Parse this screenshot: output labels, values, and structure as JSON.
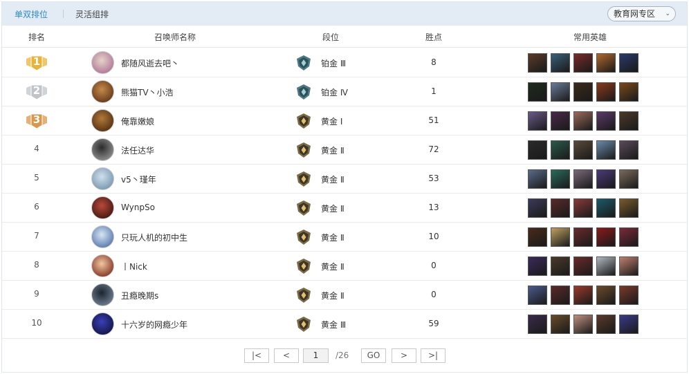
{
  "tabs": {
    "solo": "单双排位",
    "flex": "灵活组排"
  },
  "region": {
    "label": "教育网专区"
  },
  "columns": {
    "rank": "排名",
    "summoner": "召唤师名称",
    "tier": "段位",
    "lp": "胜点",
    "champs": "常用英雄"
  },
  "rows": [
    {
      "rank": "1",
      "name": "都随风逝去吧丶",
      "tier": "铂金 Ⅲ",
      "lp": "8"
    },
    {
      "rank": "2",
      "name": "熊猫TV丶小浩",
      "tier": "铂金 Ⅳ",
      "lp": "1"
    },
    {
      "rank": "3",
      "name": "俺靠嫩娘",
      "tier": "黄金 Ⅰ",
      "lp": "51"
    },
    {
      "rank": "4",
      "name": "法任达华",
      "tier": "黄金 Ⅱ",
      "lp": "72"
    },
    {
      "rank": "5",
      "name": "v5丶瑾年",
      "tier": "黄金 Ⅱ",
      "lp": "53"
    },
    {
      "rank": "6",
      "name": "WynpSo",
      "tier": "黄金 Ⅱ",
      "lp": "13"
    },
    {
      "rank": "7",
      "name": "只玩人机的初中生",
      "tier": "黄金 Ⅱ",
      "lp": "10"
    },
    {
      "rank": "8",
      "name": "丨Nick",
      "tier": "黄金 Ⅱ",
      "lp": "0"
    },
    {
      "rank": "9",
      "name": "丑瘾晚期s",
      "tier": "黄金 Ⅱ",
      "lp": "0"
    },
    {
      "rank": "10",
      "name": "十六岁的网瘾少年",
      "tier": "黄金 Ⅲ",
      "lp": "59"
    }
  ],
  "pagination": {
    "current": "1",
    "total": "/26",
    "go": "GO",
    "first": "|<",
    "prev": "<",
    "next": ">",
    "last": ">|"
  },
  "colors": {
    "accent": "#2a8ad4",
    "topbar": "#e3ebf4",
    "gold_medal": "#e8b33a",
    "silver_medal": "#c0c4c9",
    "bronze_medal": "#d8974a"
  }
}
